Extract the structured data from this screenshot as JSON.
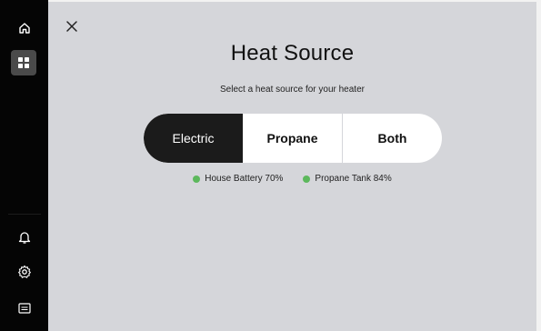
{
  "sidebar": {
    "items": [
      {
        "icon": "home-icon"
      },
      {
        "icon": "apps-grid-icon",
        "active": true
      },
      {
        "icon": "bell-icon"
      },
      {
        "icon": "gear-icon"
      },
      {
        "icon": "card-icon"
      }
    ]
  },
  "dialog": {
    "title": "Heat Source",
    "subtitle": "Select a heat source for your heater",
    "options": [
      {
        "label": "Electric",
        "selected": true
      },
      {
        "label": "Propane",
        "selected": false
      },
      {
        "label": "Both",
        "selected": false
      }
    ],
    "status": [
      {
        "label": "House Battery 70%",
        "color": "#5cb85c"
      },
      {
        "label": "Propane Tank 84%",
        "color": "#5cb85c"
      }
    ]
  },
  "colors": {
    "sidebar_bg": "#050505",
    "main_bg": "#d5d6da",
    "selected_bg": "#1b1b1b",
    "status_green": "#5cb85c"
  }
}
